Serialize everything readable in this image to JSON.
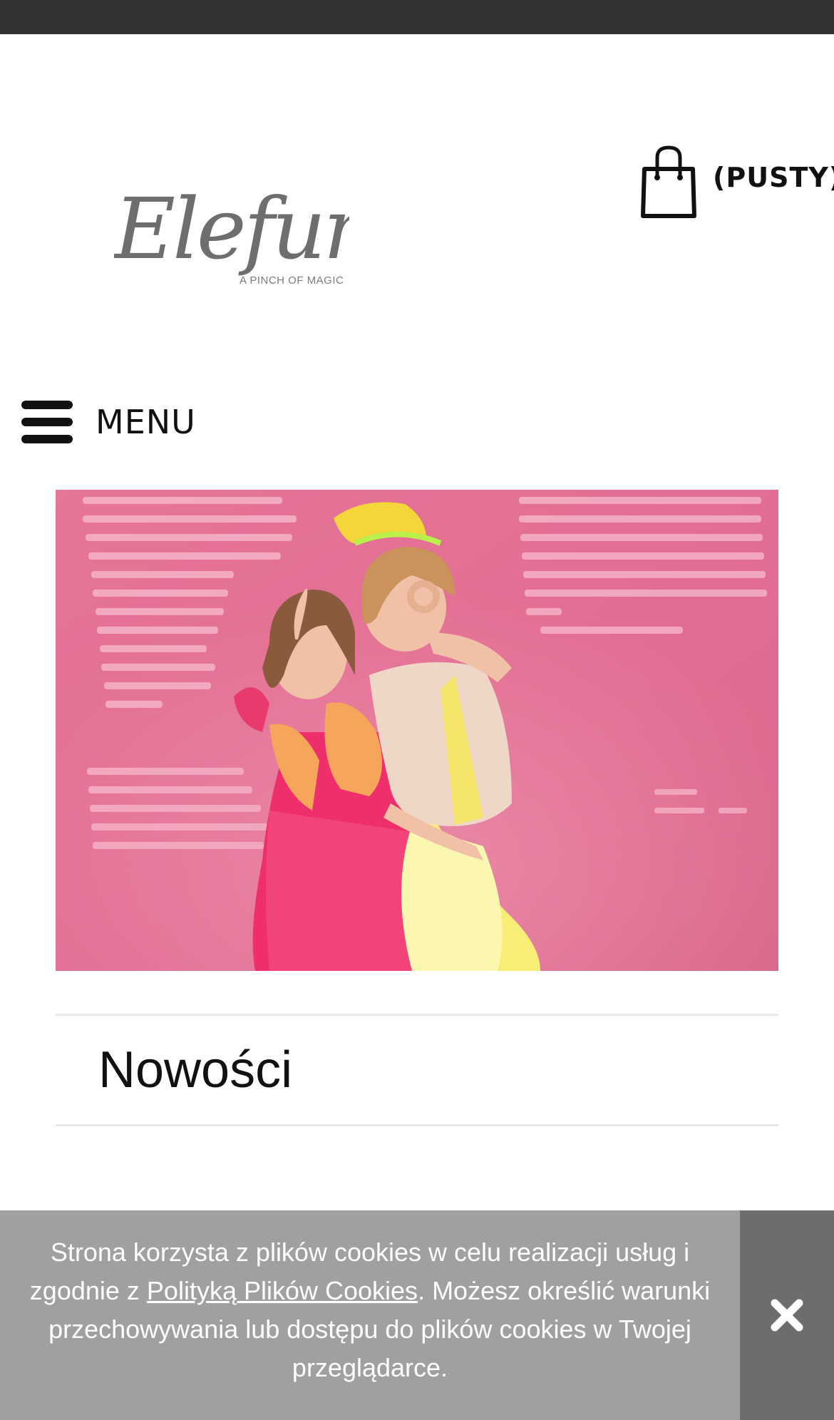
{
  "header": {
    "logo_text": "Elefunt",
    "logo_tagline": "A PINCH OF MAGIC",
    "cart_label": "(PUSTY)",
    "cart_icon": "shopping-bag-icon"
  },
  "nav": {
    "menu_label": "MENU",
    "menu_icon": "hamburger-icon"
  },
  "section": {
    "title": "Nowości"
  },
  "cookie": {
    "text_before": "Strona korzysta z plików cookies w celu realizacji usług i zgodnie z ",
    "link_text": "Polityką Plików Cookies",
    "text_after": ". Możesz określić warunki przechowywania lub dostępu do plików cookies w Twojej przeglądarce.",
    "close_icon": "close-icon"
  },
  "colors": {
    "topbar": "#333333",
    "hero_background": "#e46e93",
    "cookie_bar": "#a0a0a0",
    "cookie_close": "#6d6d6d"
  }
}
